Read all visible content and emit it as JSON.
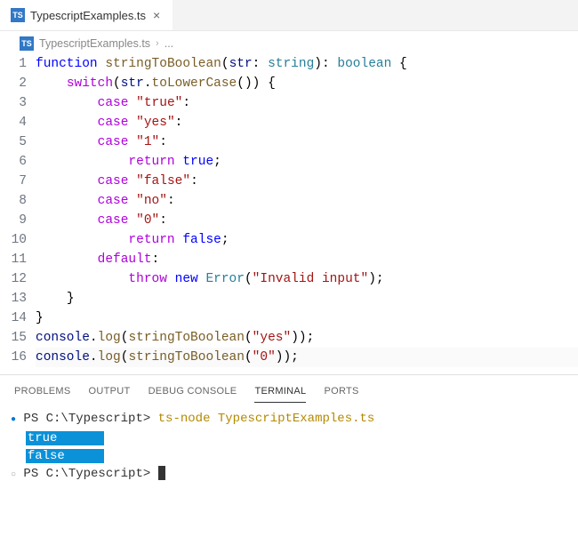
{
  "tab": {
    "filename": "TypescriptExamples.ts",
    "iconLabel": "TS"
  },
  "breadcrumb": {
    "iconLabel": "TS",
    "filename": "TypescriptExamples.ts",
    "ellipsis": "..."
  },
  "code": {
    "lines": [
      {
        "n": 1,
        "tokens": [
          [
            "kw",
            "function"
          ],
          [
            "sp",
            " "
          ],
          [
            "fn",
            "stringToBoolean"
          ],
          [
            "punc",
            "("
          ],
          [
            "var",
            "str"
          ],
          [
            "punc",
            ": "
          ],
          [
            "type",
            "string"
          ],
          [
            "punc",
            "): "
          ],
          [
            "type",
            "boolean"
          ],
          [
            "punc",
            " {"
          ]
        ]
      },
      {
        "n": 2,
        "indent": 1,
        "tokens": [
          [
            "switch",
            "switch"
          ],
          [
            "punc",
            "("
          ],
          [
            "var",
            "str"
          ],
          [
            "punc",
            "."
          ],
          [
            "fn",
            "toLowerCase"
          ],
          [
            "punc",
            "()) {"
          ]
        ]
      },
      {
        "n": 3,
        "indent": 2,
        "tokens": [
          [
            "case",
            "case"
          ],
          [
            "sp",
            " "
          ],
          [
            "str",
            "\"true\""
          ],
          [
            "punc",
            ":"
          ]
        ]
      },
      {
        "n": 4,
        "indent": 2,
        "tokens": [
          [
            "case",
            "case"
          ],
          [
            "sp",
            " "
          ],
          [
            "str",
            "\"yes\""
          ],
          [
            "punc",
            ":"
          ]
        ]
      },
      {
        "n": 5,
        "indent": 2,
        "tokens": [
          [
            "case",
            "case"
          ],
          [
            "sp",
            " "
          ],
          [
            "str",
            "\"1\""
          ],
          [
            "punc",
            ":"
          ]
        ]
      },
      {
        "n": 6,
        "indent": 3,
        "tokens": [
          [
            "return",
            "return"
          ],
          [
            "sp",
            " "
          ],
          [
            "bool",
            "true"
          ],
          [
            "punc",
            ";"
          ]
        ]
      },
      {
        "n": 7,
        "indent": 2,
        "tokens": [
          [
            "case",
            "case"
          ],
          [
            "sp",
            " "
          ],
          [
            "str",
            "\"false\""
          ],
          [
            "punc",
            ":"
          ]
        ]
      },
      {
        "n": 8,
        "indent": 2,
        "tokens": [
          [
            "case",
            "case"
          ],
          [
            "sp",
            " "
          ],
          [
            "str",
            "\"no\""
          ],
          [
            "punc",
            ":"
          ]
        ]
      },
      {
        "n": 9,
        "indent": 2,
        "tokens": [
          [
            "case",
            "case"
          ],
          [
            "sp",
            " "
          ],
          [
            "str",
            "\"0\""
          ],
          [
            "punc",
            ":"
          ]
        ]
      },
      {
        "n": 10,
        "indent": 3,
        "tokens": [
          [
            "return",
            "return"
          ],
          [
            "sp",
            " "
          ],
          [
            "bool",
            "false"
          ],
          [
            "punc",
            ";"
          ]
        ]
      },
      {
        "n": 11,
        "indent": 2,
        "tokens": [
          [
            "default",
            "default"
          ],
          [
            "punc",
            ":"
          ]
        ]
      },
      {
        "n": 12,
        "indent": 3,
        "tokens": [
          [
            "throw",
            "throw"
          ],
          [
            "sp",
            " "
          ],
          [
            "new",
            "new"
          ],
          [
            "sp",
            " "
          ],
          [
            "cls",
            "Error"
          ],
          [
            "punc",
            "("
          ],
          [
            "str",
            "\"Invalid input\""
          ],
          [
            "punc",
            ");"
          ]
        ]
      },
      {
        "n": 13,
        "indent": 1,
        "tokens": [
          [
            "punc",
            "}"
          ]
        ]
      },
      {
        "n": 14,
        "indent": 0,
        "tokens": [
          [
            "punc",
            "}"
          ]
        ]
      },
      {
        "n": 15,
        "indent": 0,
        "tokens": [
          [
            "var",
            "console"
          ],
          [
            "punc",
            "."
          ],
          [
            "fn",
            "log"
          ],
          [
            "punc",
            "("
          ],
          [
            "fn",
            "stringToBoolean"
          ],
          [
            "punc",
            "("
          ],
          [
            "str",
            "\"yes\""
          ],
          [
            "punc",
            "));"
          ]
        ]
      },
      {
        "n": 16,
        "indent": 0,
        "current": true,
        "tokens": [
          [
            "var",
            "console"
          ],
          [
            "punc",
            "."
          ],
          [
            "fn",
            "log"
          ],
          [
            "punc",
            "("
          ],
          [
            "fn",
            "stringToBoolean"
          ],
          [
            "punc",
            "("
          ],
          [
            "str",
            "\"0\""
          ],
          [
            "punc",
            "));"
          ]
        ]
      }
    ]
  },
  "panel": {
    "tabs": {
      "problems": "PROBLEMS",
      "output": "OUTPUT",
      "debugConsole": "DEBUG CONSOLE",
      "terminal": "TERMINAL",
      "ports": "PORTS"
    }
  },
  "terminal": {
    "line1": {
      "prompt": "PS C:\\Typescript>",
      "command": "ts-node TypescriptExamples.ts"
    },
    "out1": "true",
    "out2": "false",
    "line2": {
      "prompt": "PS C:\\Typescript>"
    }
  }
}
